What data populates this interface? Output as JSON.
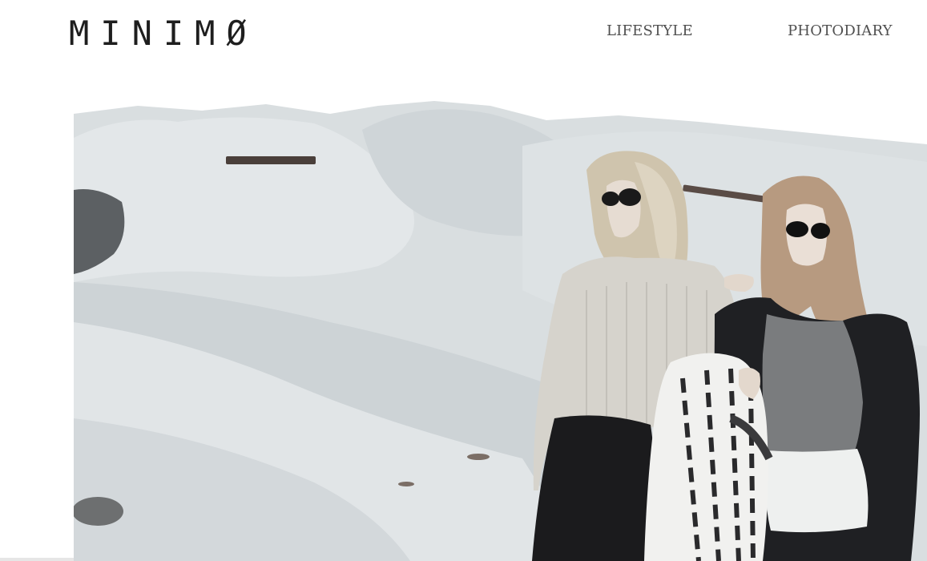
{
  "header": {
    "logo": "MINIMØ",
    "nav": [
      {
        "label": "LIFESTYLE"
      },
      {
        "label": "PHOTODIARY"
      }
    ]
  },
  "hero": {
    "image_icon": "photo-two-women-desert",
    "colors": {
      "sky": "#ffffff",
      "dune_light": "#dfe3e5",
      "dune_mid": "#c9cfd2",
      "dune_shadow": "#a9b0b4",
      "ground": "#d7dcde",
      "sweater": "#d6d3cc",
      "skirt": "#1b1b1d",
      "jacket": "#1f2023",
      "top_grey": "#7a7c7e",
      "shirt_white": "#eef0ef",
      "hair_blonde": "#d7cdb8",
      "hair_auburn": "#b79a80",
      "skin": "#e8ddd4"
    }
  }
}
